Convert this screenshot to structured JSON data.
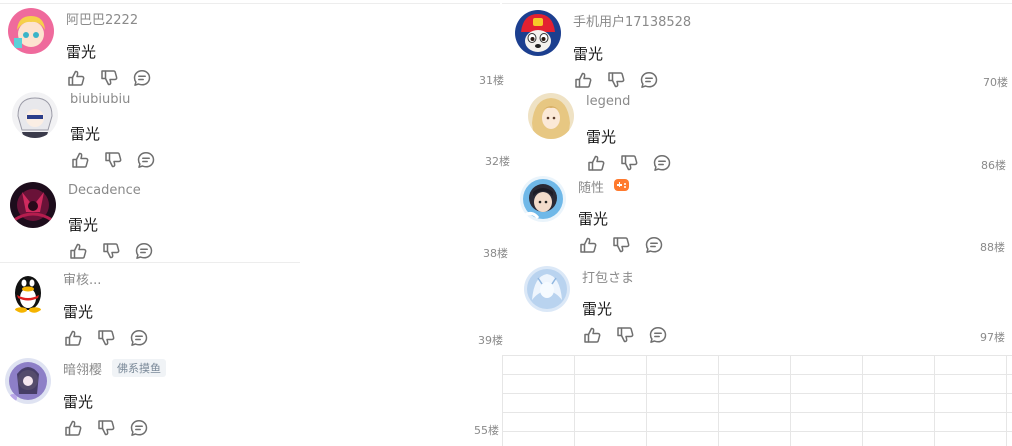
{
  "icons": {
    "like": "thumbs-up-icon",
    "dislike": "thumbs-down-icon",
    "reply": "reply-bubble-icon"
  },
  "colors": {
    "username": "#8a8a8a",
    "floor": "#8a8a8a",
    "icon_stroke": "#6f6f6f",
    "badge": "#ff7a2e"
  },
  "left_comments": [
    {
      "username": "阿巴巴2222",
      "text": "雷光",
      "floor": "31楼"
    },
    {
      "username": "biubiubiu",
      "text": "雷光",
      "floor": "32楼"
    },
    {
      "username": "Decadence",
      "text": "雷光",
      "floor": "38楼"
    },
    {
      "username": "审核...",
      "text": "雷光",
      "floor": "39楼"
    },
    {
      "username": "暗翎樱",
      "tag": "佛系摸鱼",
      "text": "雷光",
      "floor": "55楼"
    }
  ],
  "right_comments": [
    {
      "username": "手机用户17138528",
      "text": "雷光",
      "floor": "70楼"
    },
    {
      "username": "legend",
      "text": "雷光",
      "floor": "86楼"
    },
    {
      "username": "随性",
      "badge_icon": "gamepad-icon",
      "text": "雷光",
      "floor": "88楼"
    },
    {
      "username": "打包さま",
      "text": "雷光",
      "floor": "97楼"
    }
  ]
}
